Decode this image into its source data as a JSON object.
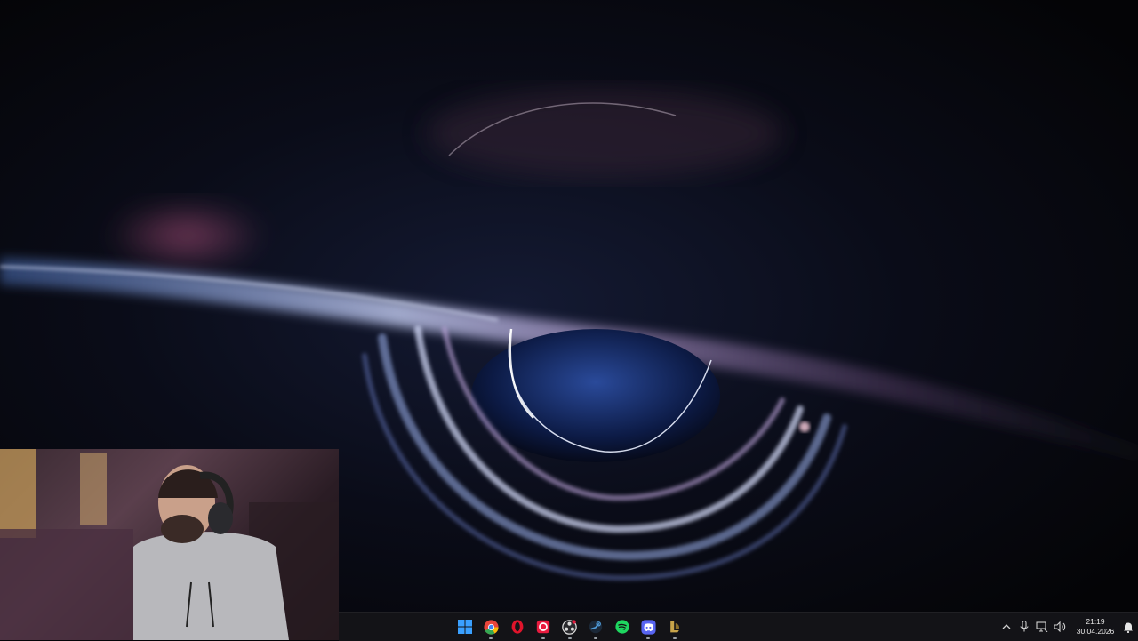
{
  "desktop": {
    "wallpaper": "black-hole-wallpaper"
  },
  "webcam": {
    "description_icon": "webcam-overlay"
  },
  "taskbar": {
    "apps": [
      {
        "name": "start-button",
        "icon": "windows-icon",
        "color": "#3aa0ff"
      },
      {
        "name": "chrome-button",
        "icon": "chrome-icon",
        "color": "#e8453c"
      },
      {
        "name": "opera-button",
        "icon": "opera-icon",
        "color": "#e0142b"
      },
      {
        "name": "app-red-button",
        "icon": "app-red-icon",
        "color": "#e81b3f"
      },
      {
        "name": "obs-button",
        "icon": "obs-icon",
        "color": "#dcdcdc"
      },
      {
        "name": "steam-button",
        "icon": "steam-icon",
        "color": "#4f9ad8"
      },
      {
        "name": "spotify-button",
        "icon": "spotify-icon",
        "color": "#1ed760"
      },
      {
        "name": "discord-button",
        "icon": "discord-icon",
        "color": "#5865f2"
      },
      {
        "name": "league-button",
        "icon": "league-icon",
        "color": "#c8a44a"
      }
    ],
    "tray": {
      "chevron": "^",
      "time": "21:19",
      "date": "30.04.2026"
    }
  }
}
